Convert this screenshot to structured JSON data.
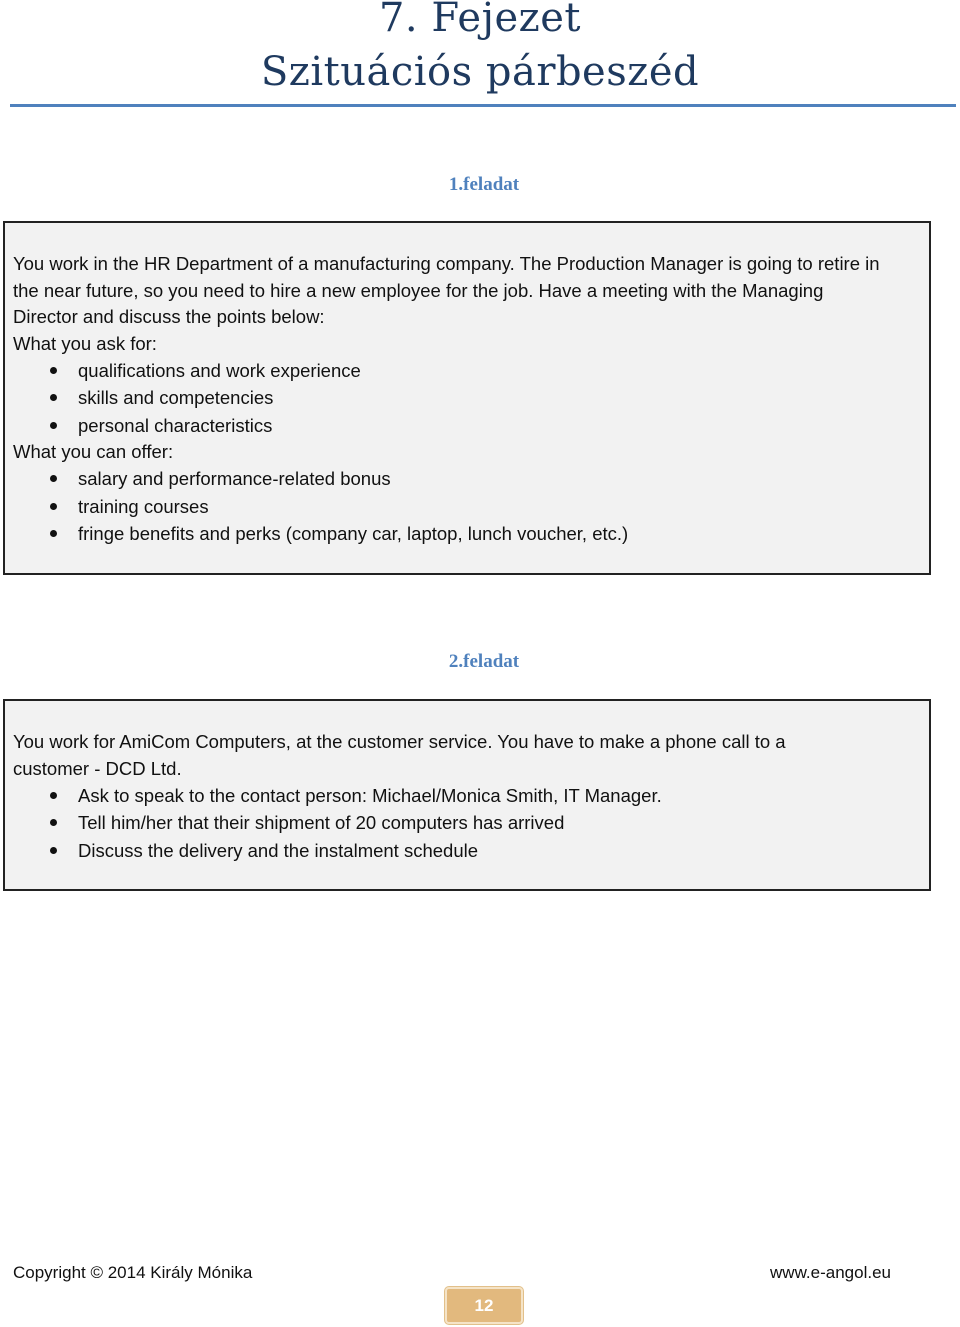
{
  "header": {
    "chapter": "7. Fejezet",
    "subtitle": "Szituációs párbeszéd"
  },
  "tasks": [
    {
      "heading": "1.feladat",
      "intro": "You work in the HR Department of a manufacturing company. The Production Manager is going to retire in the near future, so you need to hire a new employee for the job. Have a meeting with the Managing Director and discuss the points below:",
      "sections": [
        {
          "label": "What you ask for:",
          "items": [
            "qualifications and work experience",
            "skills and competencies",
            "personal characteristics"
          ]
        },
        {
          "label": "What you can offer:",
          "items": [
            "salary and performance-related bonus",
            "training courses",
            "fringe benefits and perks (company car, laptop, lunch voucher, etc.)"
          ]
        }
      ]
    },
    {
      "heading": "2.feladat",
      "intro": "You work for AmiCom Computers, at the customer service. You have to make a phone call to a customer - DCD Ltd.",
      "items": [
        "Ask to speak to the contact person: Michael/Monica Smith, IT Manager.",
        "Tell him/her that their shipment of 20 computers has arrived",
        "Discuss the delivery and the instalment schedule"
      ]
    }
  ],
  "footer": {
    "copyright": "Copyright © 2014 Király Mónika",
    "website": "www.e-angol.eu",
    "page_number": "12"
  },
  "colors": {
    "title": "#1f3a5f",
    "accent": "#4f81bd",
    "box_bg": "#f2f2f2",
    "page_badge": "#e2b97e"
  }
}
